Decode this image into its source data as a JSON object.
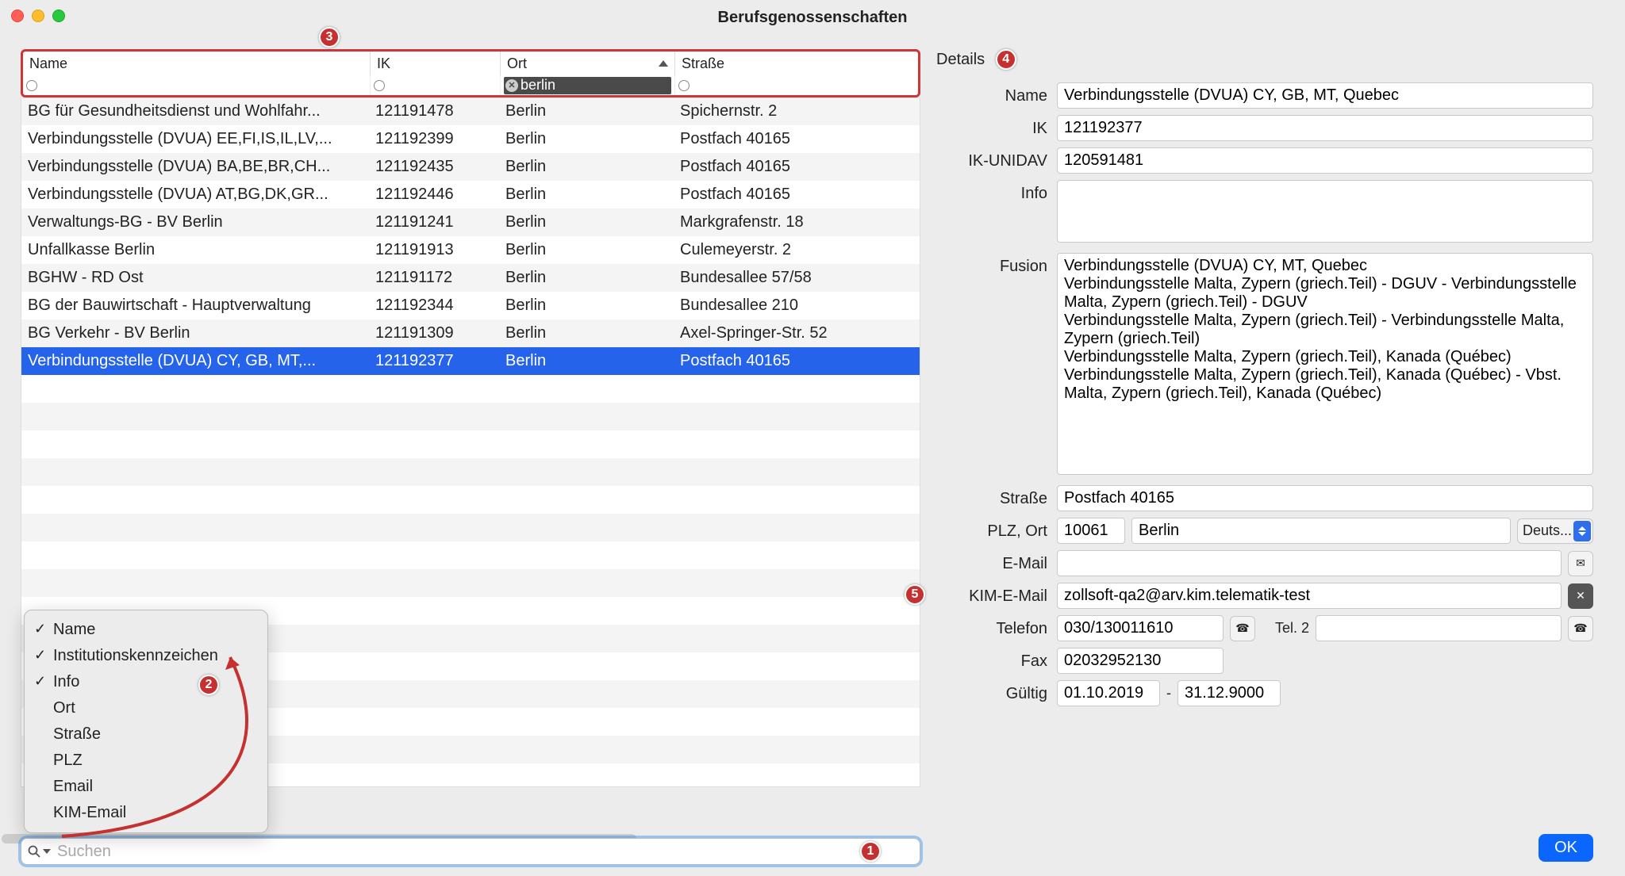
{
  "window": {
    "title": "Berufsgenossenschaften"
  },
  "columns": {
    "name": "Name",
    "ik": "IK",
    "ort": "Ort",
    "strasse": "Straße"
  },
  "filter": {
    "ort_value": "berlin"
  },
  "rows": [
    {
      "name": "BG für Gesundheitsdienst und Wohlfahr...",
      "ik": "121191478",
      "ort": "Berlin",
      "strasse": "Spichernstr. 2",
      "selected": false
    },
    {
      "name": "Verbindungsstelle (DVUA) EE,FI,IS,IL,LV,...",
      "ik": "121192399",
      "ort": "Berlin",
      "strasse": "Postfach 40165",
      "selected": false
    },
    {
      "name": "Verbindungsstelle (DVUA) BA,BE,BR,CH...",
      "ik": "121192435",
      "ort": "Berlin",
      "strasse": "Postfach 40165",
      "selected": false
    },
    {
      "name": "Verbindungsstelle (DVUA) AT,BG,DK,GR...",
      "ik": "121192446",
      "ort": "Berlin",
      "strasse": "Postfach 40165",
      "selected": false
    },
    {
      "name": "Verwaltungs-BG - BV Berlin",
      "ik": "121191241",
      "ort": "Berlin",
      "strasse": "Markgrafenstr. 18",
      "selected": false
    },
    {
      "name": "Unfallkasse Berlin",
      "ik": "121191913",
      "ort": "Berlin",
      "strasse": "Culemeyerstr. 2",
      "selected": false
    },
    {
      "name": "BGHW - RD Ost",
      "ik": "121191172",
      "ort": "Berlin",
      "strasse": "Bundesallee 57/58",
      "selected": false
    },
    {
      "name": "BG der Bauwirtschaft - Hauptverwaltung",
      "ik": "121192344",
      "ort": "Berlin",
      "strasse": "Bundesallee 210",
      "selected": false
    },
    {
      "name": "BG Verkehr - BV Berlin",
      "ik": "121191309",
      "ort": "Berlin",
      "strasse": "Axel-Springer-Str. 52",
      "selected": false
    },
    {
      "name": "Verbindungsstelle (DVUA) CY, GB, MT,...",
      "ik": "121192377",
      "ort": "Berlin",
      "strasse": "Postfach 40165",
      "selected": true
    }
  ],
  "search": {
    "placeholder": "Suchen",
    "value": ""
  },
  "popup_items": [
    {
      "label": "Name",
      "checked": true
    },
    {
      "label": "Institutionskennzeichen",
      "checked": true
    },
    {
      "label": "Info",
      "checked": true
    },
    {
      "label": "Ort",
      "checked": false
    },
    {
      "label": "Straße",
      "checked": false
    },
    {
      "label": "PLZ",
      "checked": false
    },
    {
      "label": "Email",
      "checked": false
    },
    {
      "label": "KIM-Email",
      "checked": false
    }
  ],
  "details": {
    "heading": "Details",
    "labels": {
      "name": "Name",
      "ik": "IK",
      "ik_unidav": "IK-UNIDAV",
      "info": "Info",
      "fusion": "Fusion",
      "strasse": "Straße",
      "plzort": "PLZ, Ort",
      "email": "E-Mail",
      "kimemail": "KIM-E-Mail",
      "telefon": "Telefon",
      "tel2": "Tel. 2",
      "fax": "Fax",
      "gueltig": "Gültig"
    },
    "values": {
      "name": "Verbindungsstelle (DVUA) CY, GB, MT, Quebec",
      "ik": "121192377",
      "ik_unidav": "120591481",
      "info": "",
      "fusion": "Verbindungsstelle (DVUA) CY, MT, Quebec\nVerbindungsstelle Malta, Zypern (griech.Teil) - DGUV - Verbindungsstelle Malta, Zypern (griech.Teil) - DGUV\nVerbindungsstelle Malta, Zypern (griech.Teil) - Verbindungsstelle Malta, Zypern (griech.Teil)\nVerbindungsstelle Malta, Zypern (griech.Teil), Kanada (Québec)\nVerbindungsstelle Malta, Zypern (griech.Teil), Kanada (Québec) - Vbst. Malta, Zypern (griech.Teil), Kanada (Québec)",
      "strasse": "Postfach 40165",
      "plz": "10061",
      "ort": "Berlin",
      "land": "Deuts...",
      "email": "",
      "kimemail": "zollsoft-qa2@arv.kim.telematik-test",
      "telefon": "030/130011610",
      "tel2": "",
      "fax": "02032952130",
      "gueltig_von": "01.10.2019",
      "gueltig_dash": "-",
      "gueltig_bis": "31.12.9000"
    }
  },
  "ok_button": "OK",
  "annotations": {
    "a1": "1",
    "a2": "2",
    "a3": "3",
    "a4": "4",
    "a5": "5"
  }
}
